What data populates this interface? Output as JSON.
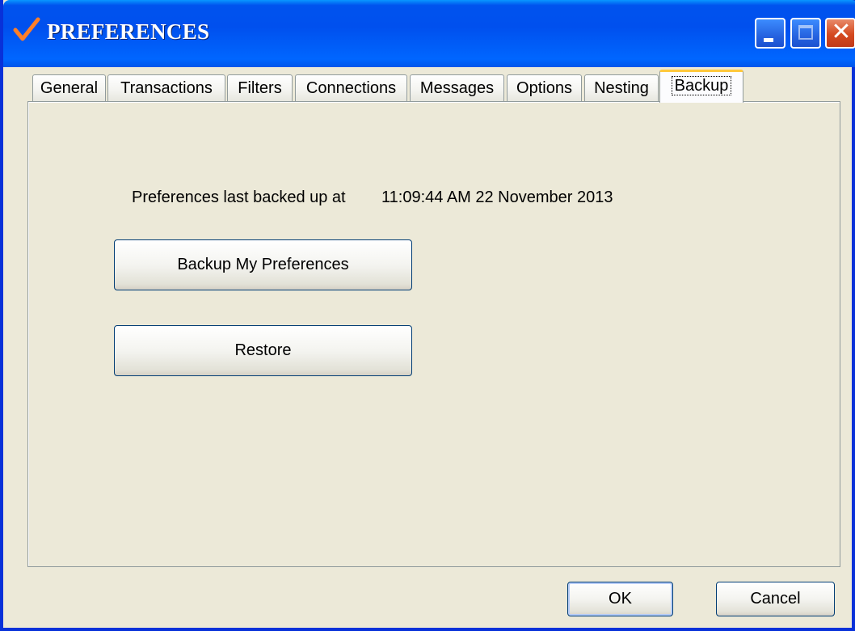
{
  "window": {
    "title": "PREFERENCES",
    "controls": {
      "minimize_icon": "minimize-icon",
      "maximize_icon": "maximize-icon",
      "close_icon": "close-icon",
      "close_glyph": "✕"
    }
  },
  "tabs": [
    {
      "label": "General",
      "active": false
    },
    {
      "label": "Transactions",
      "active": false
    },
    {
      "label": "Filters",
      "active": false
    },
    {
      "label": "Connections",
      "active": false
    },
    {
      "label": "Messages",
      "active": false
    },
    {
      "label": "Options",
      "active": false
    },
    {
      "label": "Nesting",
      "active": false
    },
    {
      "label": "Backup",
      "active": true
    }
  ],
  "backup": {
    "last_backup_label": "Preferences last backed up at",
    "last_backup_time": "11:09:44 AM 22 November 2013",
    "backup_button": "Backup My Preferences",
    "restore_button": "Restore"
  },
  "footer": {
    "ok_button": "OK",
    "cancel_button": "Cancel"
  },
  "colors": {
    "titlebar": "#0050ee",
    "window_bg": "#ece9d8",
    "active_tab_accent": "#ffc83c",
    "check_icon": "#ff7f27"
  }
}
